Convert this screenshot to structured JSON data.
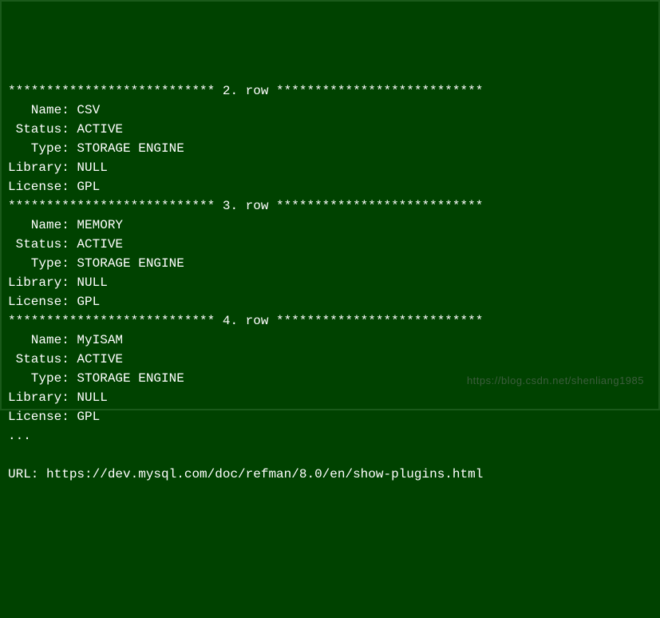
{
  "rows": [
    {
      "separator": "*************************** 2. row ***************************",
      "fields": [
        {
          "label": "   Name:",
          "value": " CSV"
        },
        {
          "label": " Status:",
          "value": " ACTIVE"
        },
        {
          "label": "   Type:",
          "value": " STORAGE ENGINE"
        },
        {
          "label": "Library:",
          "value": " NULL"
        },
        {
          "label": "License:",
          "value": " GPL"
        }
      ]
    },
    {
      "separator": "*************************** 3. row ***************************",
      "fields": [
        {
          "label": "   Name:",
          "value": " MEMORY"
        },
        {
          "label": " Status:",
          "value": " ACTIVE"
        },
        {
          "label": "   Type:",
          "value": " STORAGE ENGINE"
        },
        {
          "label": "Library:",
          "value": " NULL"
        },
        {
          "label": "License:",
          "value": " GPL"
        }
      ]
    },
    {
      "separator": "*************************** 4. row ***************************",
      "fields": [
        {
          "label": "   Name:",
          "value": " MyISAM"
        },
        {
          "label": " Status:",
          "value": " ACTIVE"
        },
        {
          "label": "   Type:",
          "value": " STORAGE ENGINE"
        },
        {
          "label": "Library:",
          "value": " NULL"
        },
        {
          "label": "License:",
          "value": " GPL"
        }
      ]
    }
  ],
  "ellipsis": "...",
  "blank": "",
  "url_line": "URL: https://dev.mysql.com/doc/refman/8.0/en/show-plugins.html",
  "watermark": "https://blog.csdn.net/shenliang1985"
}
